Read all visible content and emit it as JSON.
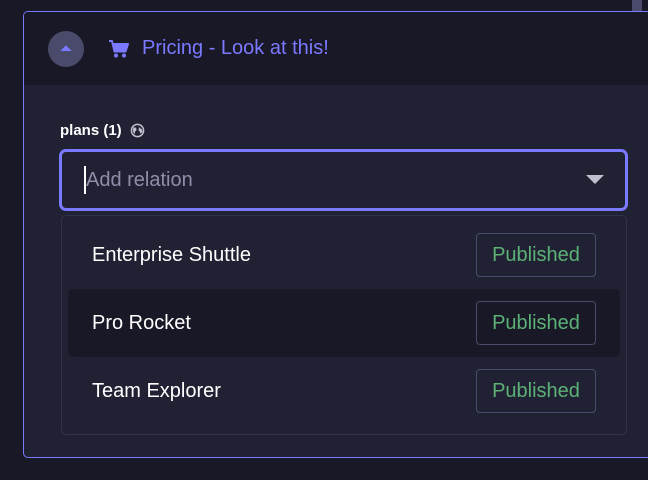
{
  "card": {
    "title": "Pricing - Look at this!",
    "collapse_icon": "chevron-up-icon",
    "entity_icon": "shopping-cart-icon",
    "accent_color": "#7b79ff"
  },
  "field": {
    "label": "plans (1)",
    "label_icon": "globe-icon",
    "input": {
      "placeholder": "Add relation",
      "value": ""
    },
    "dropdown_icon": "caret-down-icon"
  },
  "options": [
    {
      "label": "Enterprise Shuttle",
      "status": "Published"
    },
    {
      "label": "Pro Rocket",
      "status": "Published"
    },
    {
      "label": "Team Explorer",
      "status": "Published"
    }
  ],
  "colors": {
    "background": "#181826",
    "surface": "#212134",
    "status_published": "#5cb176"
  }
}
